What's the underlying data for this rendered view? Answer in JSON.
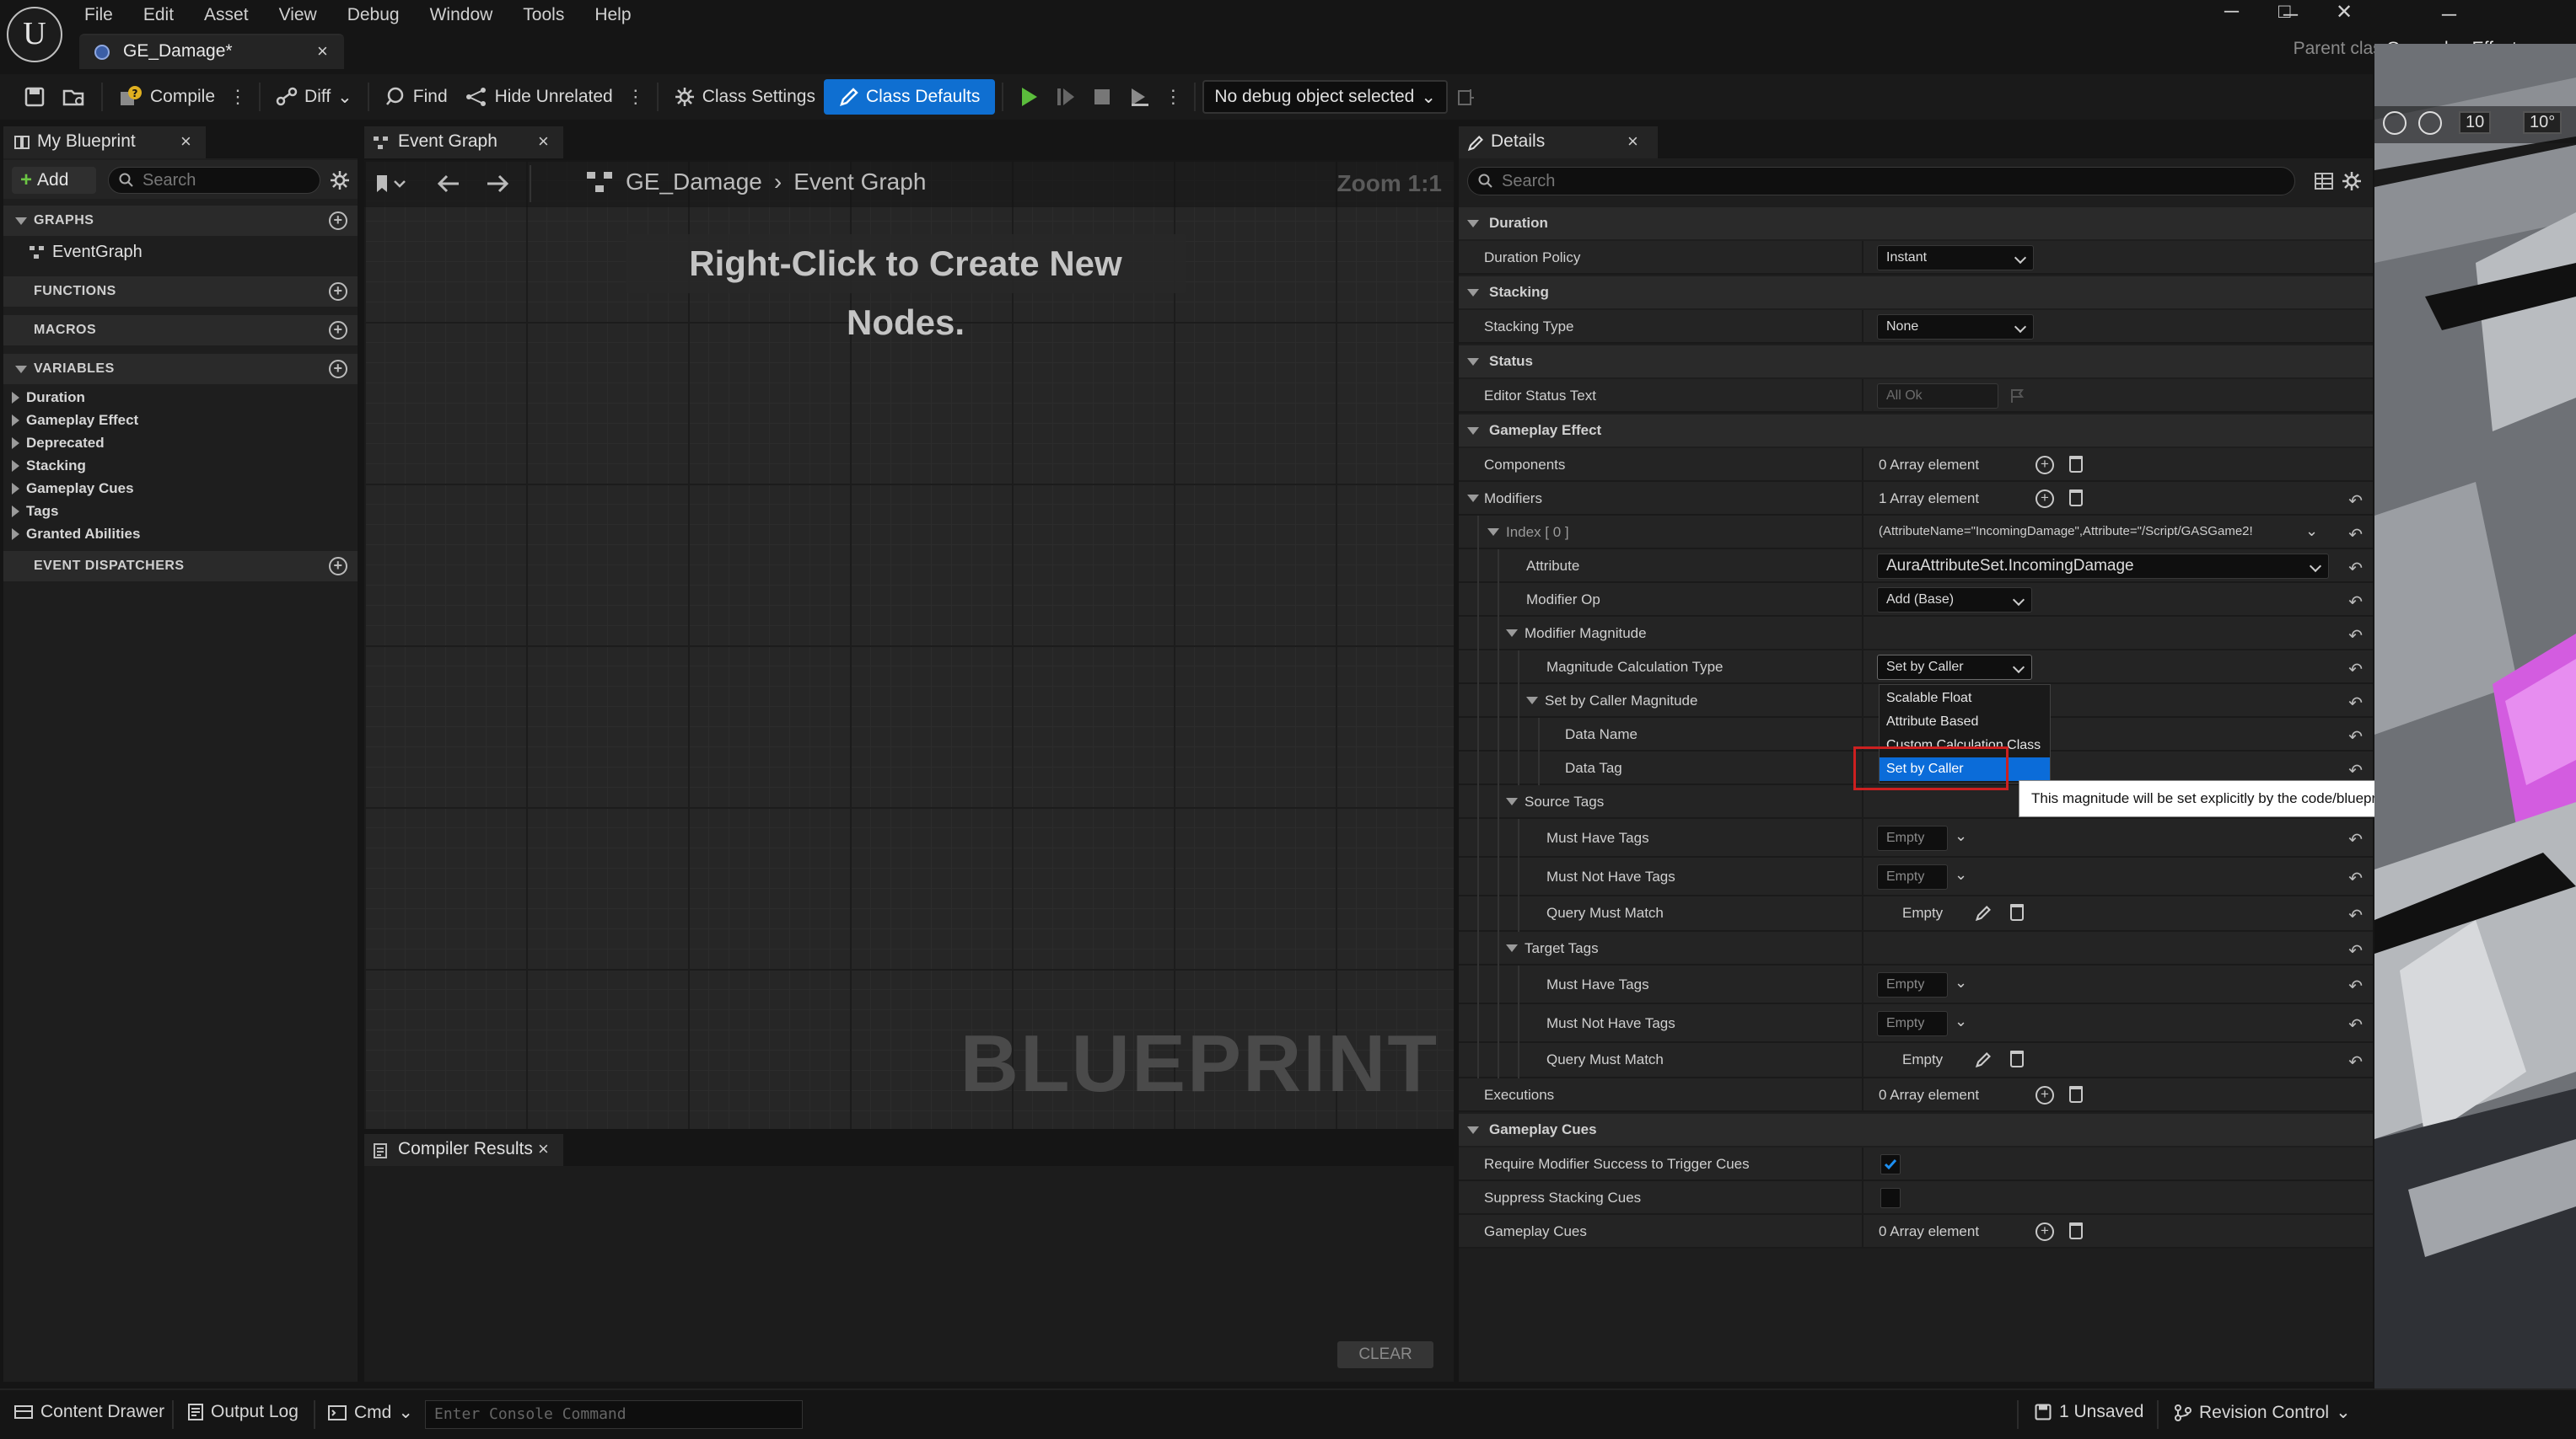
{
  "menu": [
    "File",
    "Edit",
    "Asset",
    "View",
    "Debug",
    "Window",
    "Tools",
    "Help"
  ],
  "doc_tab": {
    "title": "GE_Damage*",
    "close": "×"
  },
  "parent_class": {
    "label": "Parent class:",
    "value": "Gameplay Effect"
  },
  "window_buttons": {
    "minimize": "─",
    "maximize": "□",
    "close": "✕"
  },
  "toolbar": {
    "compile": "Compile",
    "diff": "Diff",
    "find": "Find",
    "hide_unrelated": "Hide Unrelated",
    "class_settings": "Class Settings",
    "class_defaults": "Class Defaults",
    "debug_object": "No debug object selected"
  },
  "my_blueprint": {
    "tab": "My Blueprint",
    "add": "Add",
    "search_placeholder": "Search",
    "sections": {
      "graphs": "GRAPHS",
      "functions": "FUNCTIONS",
      "macros": "MACROS",
      "variables": "VARIABLES",
      "event_dispatchers": "EVENT DISPATCHERS"
    },
    "graph_items": [
      "EventGraph"
    ],
    "variable_categories": [
      "Duration",
      "Gameplay Effect",
      "Deprecated",
      "Stacking",
      "Gameplay Cues",
      "Tags",
      "Granted Abilities"
    ]
  },
  "event_graph": {
    "tab": "Event Graph",
    "breadcrumb_root": "GE_Damage",
    "breadcrumb_leaf": "Event Graph",
    "zoom": "Zoom 1:1",
    "hint": "Right-Click to Create New Nodes.",
    "watermark": "BLUEPRINT"
  },
  "compiler_results": {
    "tab": "Compiler Results",
    "clear": "CLEAR"
  },
  "details": {
    "tab": "Details",
    "search_placeholder": "Search",
    "rows": {
      "duration_cat": "Duration",
      "duration_policy": "Duration Policy",
      "duration_policy_val": "Instant",
      "stacking_cat": "Stacking",
      "stacking_type": "Stacking Type",
      "stacking_type_val": "None",
      "status_cat": "Status",
      "editor_status_text": "Editor Status Text",
      "editor_status_val": "All Ok",
      "ge_cat": "Gameplay Effect",
      "components": "Components",
      "components_val": "0 Array element",
      "modifiers": "Modifiers",
      "modifiers_val": "1 Array element",
      "index0": "Index [ 0 ]",
      "index0_val": "(AttributeName=\"IncomingDamage\",Attribute=\"/Script/GASGame2!",
      "attribute": "Attribute",
      "attribute_val": "AuraAttributeSet.IncomingDamage",
      "modifier_op": "Modifier Op",
      "modifier_op_val": "Add (Base)",
      "modifier_magnitude": "Modifier Magnitude",
      "magnitude_calc_type": "Magnitude Calculation Type",
      "magnitude_calc_type_val": "Set by Caller",
      "set_by_caller_magnitude": "Set by Caller Magnitude",
      "data_name": "Data Name",
      "data_tag": "Data Tag",
      "source_tags": "Source Tags",
      "must_have_tags": "Must Have Tags",
      "must_not_have_tags": "Must Not Have Tags",
      "query_must_match": "Query Must Match",
      "target_tags": "Target Tags",
      "empty": "Empty",
      "executions": "Executions",
      "executions_val": "0 Array element",
      "gc_cat": "Gameplay Cues",
      "require_modifier_success": "Require Modifier Success to Trigger Cues",
      "suppress_stacking_cues": "Suppress Stacking Cues",
      "gameplay_cues": "Gameplay Cues",
      "gameplay_cues_val": "0 Array element"
    },
    "dropdown_options": [
      "Scalable Float",
      "Attribute Based",
      "Custom Calculation Class",
      "Set by Caller"
    ],
    "tooltip": "This magnitude will be set explicitly by the code/blueprint that creates the spec."
  },
  "viewport": {
    "label": "10",
    "label2": "10°"
  },
  "statusbar": {
    "content_drawer": "Content Drawer",
    "output_log": "Output Log",
    "cmd": "Cmd",
    "console_placeholder": "Enter Console Command",
    "unsaved": "1 Unsaved",
    "revision_control": "Revision Control"
  },
  "colors": {
    "accent": "#0f6fd1",
    "highlight_red": "#cc2020",
    "play_green": "#5bbd3c"
  }
}
